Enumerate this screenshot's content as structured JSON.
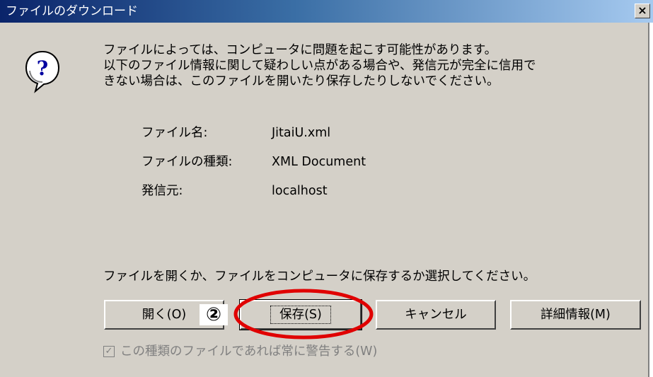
{
  "window": {
    "title": "ファイルのダウンロード",
    "close_label": "×"
  },
  "warning": {
    "lines": [
      "ファイルによっては、コンピュータに問題を起こす可能性があります。",
      "以下のファイル情報に関して疑わしい点がある場合や、発信元が完全に信用で",
      "きない場合は、このファイルを開いたり保存したりしないでください。"
    ]
  },
  "file_info": {
    "name_label": "ファイル名:",
    "name_value": "JitaiU.xml",
    "type_label": "ファイルの種類:",
    "type_value": "XML Document",
    "source_label": "発信元:",
    "source_value": "localhost"
  },
  "prompt": "ファイルを開くか、ファイルをコンピュータに保存するか選択してください。",
  "buttons": {
    "open": "開く(O)",
    "save": "保存(S)",
    "cancel": "キャンセル",
    "details": "詳細情報(M)"
  },
  "annotation": {
    "step_marker": "②",
    "highlight_color": "#e00000"
  },
  "checkbox": {
    "label": "この種類のファイルであれば常に警告する(W)",
    "checked": true,
    "disabled": true
  },
  "icons": {
    "help": "question-balloon-icon",
    "close": "close-icon",
    "check": "checkmark-icon"
  }
}
